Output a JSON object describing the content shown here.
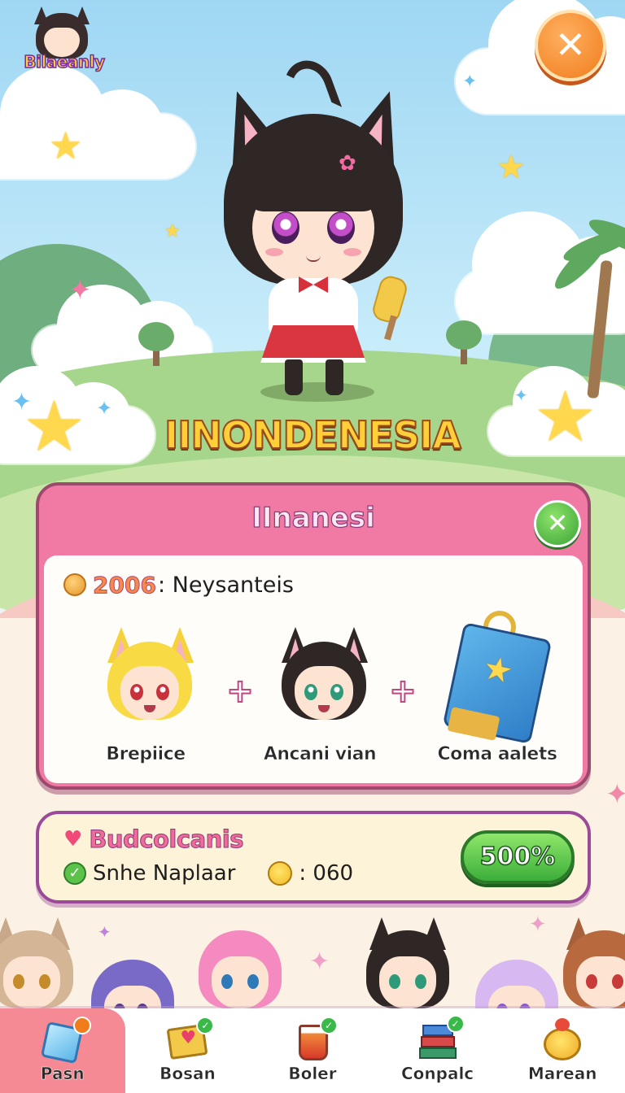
{
  "header": {
    "logo_text": "Bilaeanly",
    "close_label": "✕"
  },
  "hero": {
    "title": "IINONDENESIA"
  },
  "reward_panel": {
    "title": "IInanesi",
    "close_label": "✕",
    "year": "2006",
    "subtitle": ": Neysanteis",
    "items": [
      {
        "label": "Brepiice",
        "icon": "blonde-cat-girl-avatar"
      },
      {
        "label": "Ancani vian",
        "icon": "black-cat-girl-avatar"
      },
      {
        "label": "Coma aalets",
        "icon": "blue-gift-bag-icon"
      }
    ],
    "plus_symbol": "+"
  },
  "status_bar": {
    "title": "Budcolcanis",
    "name": "Snhe Naplaar",
    "count": ": 060",
    "percent_button": "500%"
  },
  "nav": {
    "items": [
      {
        "label": "Pasn",
        "icon": "gem-cube-icon",
        "active": true
      },
      {
        "label": "Bosan",
        "icon": "envelope-heart-icon",
        "active": false
      },
      {
        "label": "Boler",
        "icon": "juice-cup-icon",
        "active": false
      },
      {
        "label": "Conpalc",
        "icon": "book-stack-icon",
        "active": false
      },
      {
        "label": "Marean",
        "icon": "chick-hamster-icon",
        "active": false
      }
    ]
  },
  "colors": {
    "panel_pink": "#f07aa3",
    "status_purple": "#9b4a9a",
    "accent_green": "#3cae3a",
    "close_orange": "#f07c1c"
  }
}
